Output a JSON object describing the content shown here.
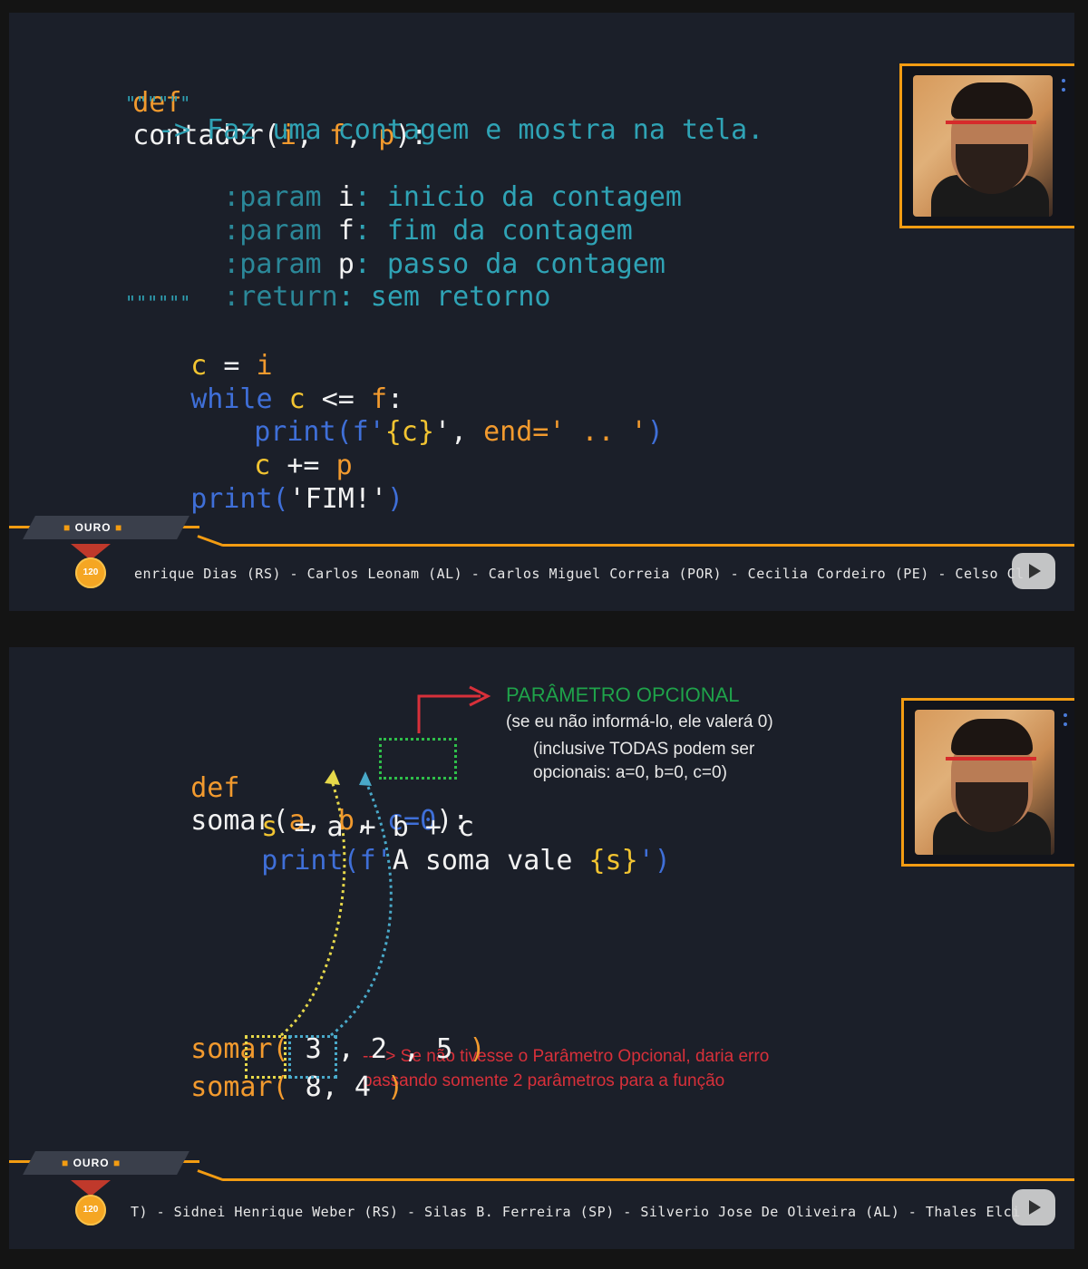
{
  "panel1": {
    "code": {
      "def_kw": "def",
      "func_name": "contador(",
      "p_i": "i",
      "sep1": ", ",
      "p_f": "f",
      "sep2": ", ",
      "p_p": "p",
      "close": "):",
      "docquote_open": "\"\"\"\"\"\"",
      "doc_line1": "-> Faz uma contagem e mostra na tela.",
      "doc_line2_tag": ":param ",
      "doc_line2_var": "i",
      "doc_line2_rest": ": inicio da contagem",
      "doc_line3_tag": ":param ",
      "doc_line3_var": "f",
      "doc_line3_rest": ": fim da contagem",
      "doc_line4_tag": ":param ",
      "doc_line4_var": "p",
      "doc_line4_rest": ": passo da contagem",
      "doc_line5_tag": ":return",
      "doc_line5_rest": ": sem retorno",
      "docquote_close": "\"\"\"\"\"\"",
      "assign_c": "c",
      "assign_eq": " = ",
      "assign_i": "i",
      "while_kw": "while ",
      "while_c": "c",
      "while_op": " <= ",
      "while_f": "f",
      "while_colon": ":",
      "print1_kw": "print(f'",
      "print1_brace": "{c}",
      "print1_mid": "', ",
      "print1_end": "end=' .. '",
      "print1_close": ")",
      "inc_c": "c",
      "inc_op": " += ",
      "inc_p": "p",
      "print2_kw": "print(",
      "print2_str": "'FIM!'",
      "print2_close": ")"
    },
    "bar": {
      "tag_label": "OURO",
      "medal_label": "120",
      "ticker": "enrique Dias (RS) - Carlos Leonam (AL) - Carlos Miguel Correia (POR) - Cecilia Cordeiro (PE) - Celso Cl"
    }
  },
  "panel2": {
    "code": {
      "def_kw": "def",
      "func_name": "somar(",
      "p_a": "a",
      "sep1": ", ",
      "p_b": "b",
      "sep2": ", ",
      "p_c": "c=0",
      "close": "):",
      "s_var": "s",
      "s_expr": " = a + b + c",
      "print_kw": "print(f'",
      "print_str": "A soma vale ",
      "print_brace": "{s}",
      "print_close": "')",
      "call1_kw": "somar(",
      "call1_args": " 3 , 2 , 5 ",
      "call1_close": ")",
      "call2_kw": "somar(",
      "call2_a": " 8",
      "call2_sep": ",",
      "call2_b": " 4 ",
      "call2_close": ")"
    },
    "annotations": {
      "title": "PARÂMETRO OPCIONAL",
      "line1": "(se eu não informá-lo, ele valerá 0)",
      "line2": "(inclusive TODAS podem ser",
      "line3": "opcionais: a=0, b=0, c=0)",
      "error1": "----> Se não tivesse o Parâmetro Opcional, daria erro",
      "error2": "passando somente 2 parâmetros para a função"
    },
    "bar": {
      "tag_label": "OURO",
      "medal_label": "120",
      "ticker": "T) - Sidnei Henrique Weber (RS) - Silas B. Ferreira (SP) - Silverio Jose De Oliveira (AL) - Thales Elci"
    }
  },
  "colors": {
    "background": "#1b1f29",
    "keyword_orange": "#f29a2e",
    "param_yellow": "#f2c431",
    "builtin_blue": "#3f6fd8",
    "docstring_cyan": "#2fa3b5",
    "frame_orange": "#f39c12",
    "annotation_green": "#1fa34a",
    "annotation_red": "#d8303a"
  }
}
